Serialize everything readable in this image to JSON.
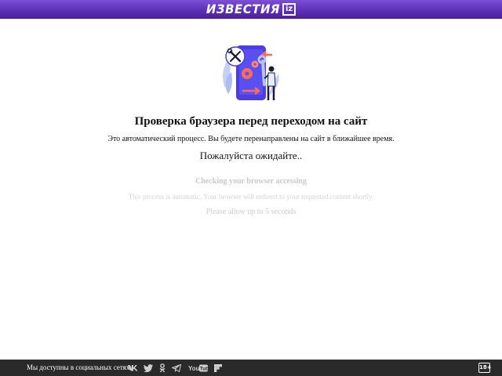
{
  "header": {
    "logo_text": "ИЗВЕСТИЯ",
    "logo_badge": "iz",
    "background_color": "#5e2fb8"
  },
  "illustration": {
    "icon": "maintenance-phone-tools-illustration",
    "colors": {
      "phone": "#4b3fe0",
      "wrench_circle": "#ffffff",
      "gear": "#ff6b5b",
      "arrows": "#ff6b5b",
      "leaves": "#c5cff7",
      "person": "#1e1a3c"
    }
  },
  "main": {
    "title_ru": "Проверка браузера перед переходом на сайт",
    "subtitle_ru": "Это автоматический процесс. Вы будете перенаправлены на сайт в ближайшее время.",
    "wait_ru": "Пожалуйста ожидайте..",
    "title_en": "Checking your browser accessing",
    "subtitle_en": "This process is automatic. Your browser will redirect to your requested content shortly.",
    "wait_en": "Please allow up to 5 seconds"
  },
  "footer": {
    "label": "Мы доступны в социальных сетях:",
    "socials": [
      {
        "name": "vk-icon",
        "text": "VK"
      },
      {
        "name": "twitter-icon",
        "text": ""
      },
      {
        "name": "odnoklassniki-icon",
        "text": ""
      },
      {
        "name": "telegram-icon",
        "text": ""
      },
      {
        "name": "youtube-icon",
        "text": "YouTube"
      },
      {
        "name": "flipboard-icon",
        "text": ""
      }
    ],
    "age_rating": "18+",
    "background_color": "#2a2a2a"
  }
}
